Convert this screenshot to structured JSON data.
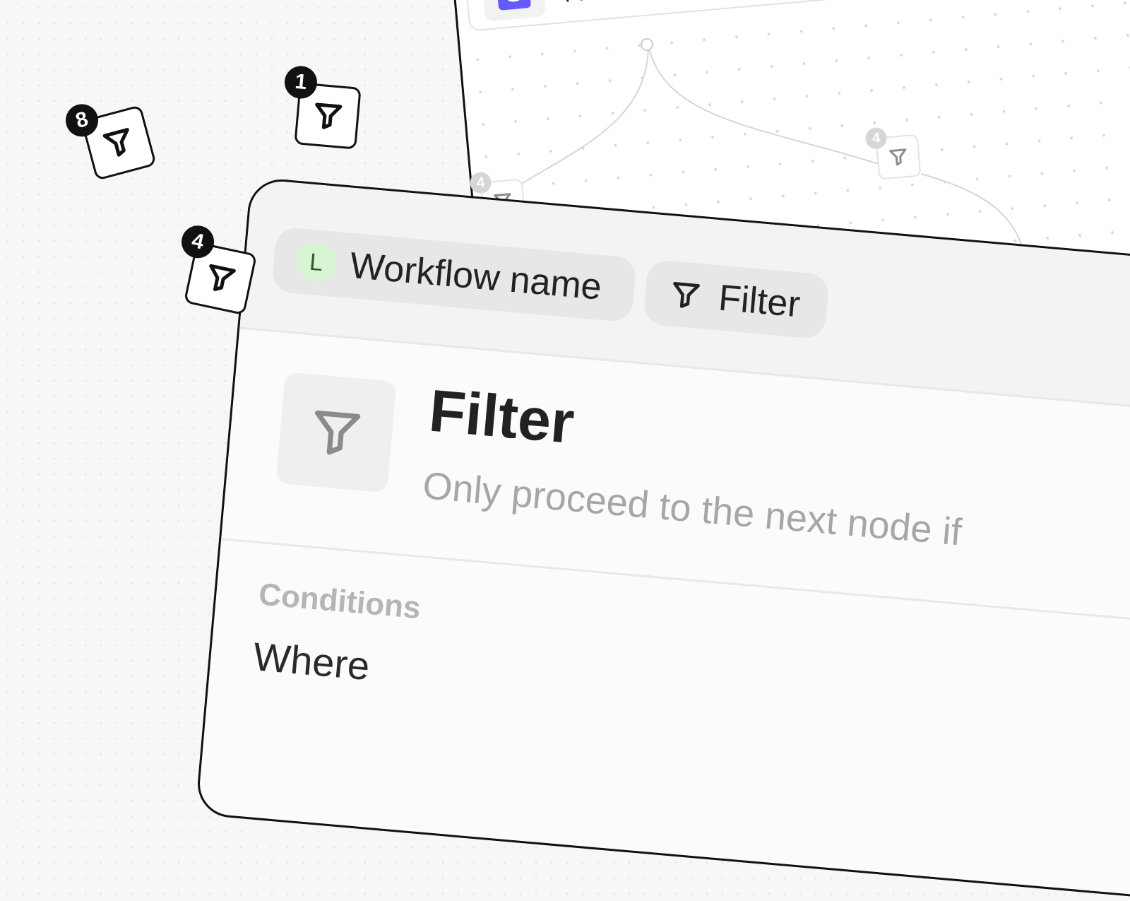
{
  "canvas": {
    "stripe_node": {
      "logo_letter": "S",
      "title": "Find Stripe Customer"
    }
  },
  "floating_filters": [
    {
      "badge": "8"
    },
    {
      "badge": "1"
    },
    {
      "badge": "4"
    }
  ],
  "faint_filters": [
    {
      "badge": "4"
    },
    {
      "badge": "4"
    }
  ],
  "panel": {
    "breadcrumb": {
      "workflow_avatar": "L",
      "workflow_name": "Workflow name",
      "node_name": "Filter"
    },
    "title": "Filter",
    "subtitle": "Only proceed to the next node if",
    "conditions_label": "Conditions",
    "where_label": "Where"
  },
  "colors": {
    "stripe": "#635bff",
    "avatar_bg": "#d8f5d3",
    "badge": "#111111"
  },
  "icons": [
    "filter-icon",
    "stripe-logo"
  ]
}
